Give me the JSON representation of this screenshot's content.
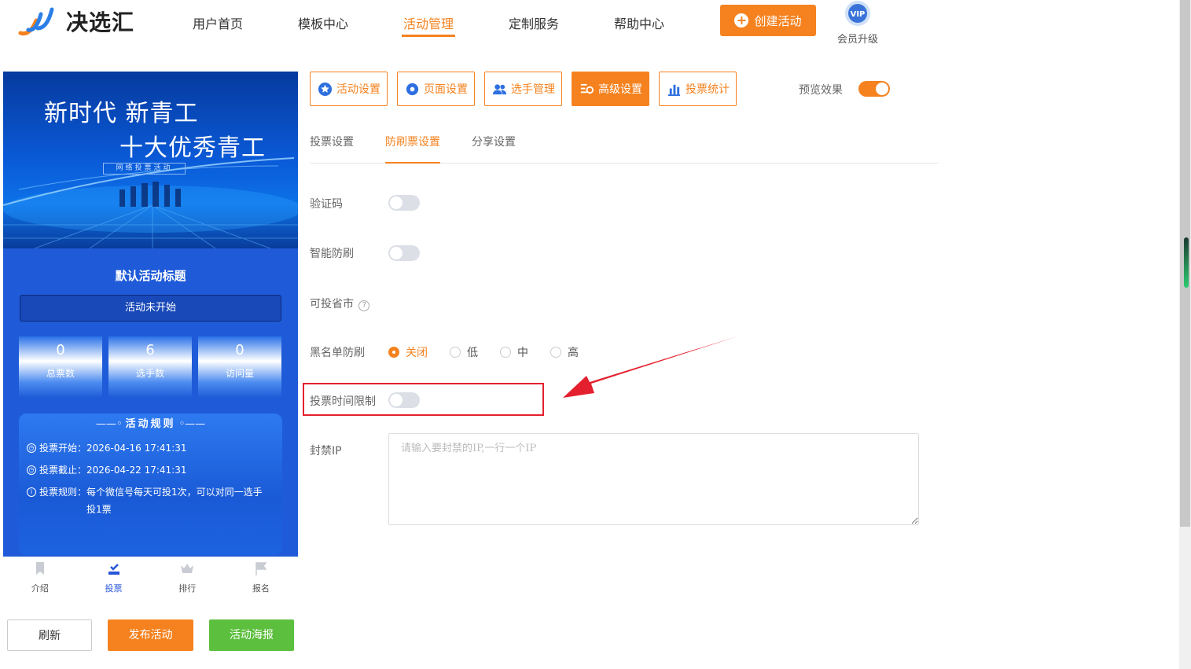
{
  "header": {
    "logo_text": "决选汇",
    "nav": [
      "用户首页",
      "模板中心",
      "活动管理",
      "定制服务",
      "帮助中心"
    ],
    "active_nav_index": 2,
    "create_button": "创建活动",
    "vip_badge": "VIP",
    "vip_label": "会员升级"
  },
  "preview": {
    "banner_line1": "新时代 新青工",
    "banner_line2": "十大优秀青工",
    "banner_tag": "网络投票活动",
    "activity_title": "默认活动标题",
    "status": "活动未开始",
    "stats": [
      {
        "value": "0",
        "label": "总票数"
      },
      {
        "value": "6",
        "label": "选手数"
      },
      {
        "value": "0",
        "label": "访问量"
      }
    ],
    "rules_title": "活动规则",
    "rules": [
      {
        "key": "投票开始：",
        "value": "2026-04-16 17:41:31"
      },
      {
        "key": "投票截止：",
        "value": "2026-04-22 17:41:31"
      },
      {
        "key": "投票规则：",
        "value": "每个微信号每天可投1次，可以对同一选手投1票"
      }
    ],
    "tabs": [
      "介绍",
      "投票",
      "排行",
      "报名"
    ],
    "active_tab_index": 1
  },
  "actions": {
    "refresh": "刷新",
    "publish": "发布活动",
    "poster": "活动海报"
  },
  "toolbar": {
    "buttons": [
      "活动设置",
      "页面设置",
      "选手管理",
      "高级设置",
      "投票统计"
    ],
    "active_index": 3,
    "preview_label": "预览效果",
    "preview_on": true
  },
  "subtabs": {
    "items": [
      "投票设置",
      "防刷票设置",
      "分享设置"
    ],
    "active_index": 1
  },
  "form": {
    "captcha_label": "验证码",
    "captcha_on": false,
    "smart_label": "智能防刷",
    "smart_on": false,
    "region_label": "可投省市",
    "region_help": "?",
    "blacklist_label": "黑名单防刷",
    "blacklist_options": [
      "关闭",
      "低",
      "中",
      "高"
    ],
    "blacklist_selected": 0,
    "time_limit_label": "投票时间限制",
    "time_limit_on": false,
    "ip_label": "封禁IP",
    "ip_placeholder": "请输入要封禁的IP,一行一个IP",
    "ip_value": ""
  },
  "colors": {
    "accent": "#f5821f",
    "green": "#5cbf3e",
    "annotation": "#e5202e",
    "preview_blue": "#1f5bd8"
  }
}
